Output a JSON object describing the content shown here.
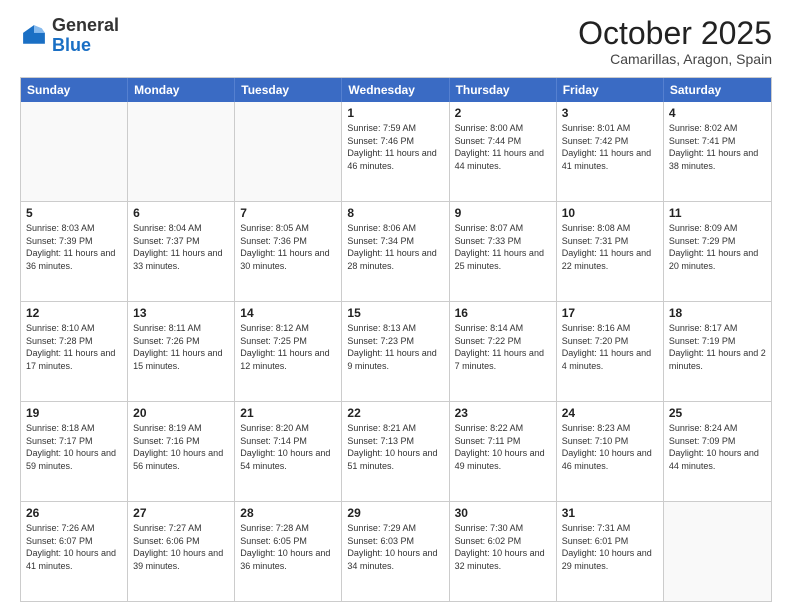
{
  "logo": {
    "general": "General",
    "blue": "Blue"
  },
  "header": {
    "month": "October 2025",
    "location": "Camarillas, Aragon, Spain"
  },
  "days": [
    "Sunday",
    "Monday",
    "Tuesday",
    "Wednesday",
    "Thursday",
    "Friday",
    "Saturday"
  ],
  "rows": [
    [
      {
        "day": "",
        "info": ""
      },
      {
        "day": "",
        "info": ""
      },
      {
        "day": "",
        "info": ""
      },
      {
        "day": "1",
        "info": "Sunrise: 7:59 AM\nSunset: 7:46 PM\nDaylight: 11 hours and 46 minutes."
      },
      {
        "day": "2",
        "info": "Sunrise: 8:00 AM\nSunset: 7:44 PM\nDaylight: 11 hours and 44 minutes."
      },
      {
        "day": "3",
        "info": "Sunrise: 8:01 AM\nSunset: 7:42 PM\nDaylight: 11 hours and 41 minutes."
      },
      {
        "day": "4",
        "info": "Sunrise: 8:02 AM\nSunset: 7:41 PM\nDaylight: 11 hours and 38 minutes."
      }
    ],
    [
      {
        "day": "5",
        "info": "Sunrise: 8:03 AM\nSunset: 7:39 PM\nDaylight: 11 hours and 36 minutes."
      },
      {
        "day": "6",
        "info": "Sunrise: 8:04 AM\nSunset: 7:37 PM\nDaylight: 11 hours and 33 minutes."
      },
      {
        "day": "7",
        "info": "Sunrise: 8:05 AM\nSunset: 7:36 PM\nDaylight: 11 hours and 30 minutes."
      },
      {
        "day": "8",
        "info": "Sunrise: 8:06 AM\nSunset: 7:34 PM\nDaylight: 11 hours and 28 minutes."
      },
      {
        "day": "9",
        "info": "Sunrise: 8:07 AM\nSunset: 7:33 PM\nDaylight: 11 hours and 25 minutes."
      },
      {
        "day": "10",
        "info": "Sunrise: 8:08 AM\nSunset: 7:31 PM\nDaylight: 11 hours and 22 minutes."
      },
      {
        "day": "11",
        "info": "Sunrise: 8:09 AM\nSunset: 7:29 PM\nDaylight: 11 hours and 20 minutes."
      }
    ],
    [
      {
        "day": "12",
        "info": "Sunrise: 8:10 AM\nSunset: 7:28 PM\nDaylight: 11 hours and 17 minutes."
      },
      {
        "day": "13",
        "info": "Sunrise: 8:11 AM\nSunset: 7:26 PM\nDaylight: 11 hours and 15 minutes."
      },
      {
        "day": "14",
        "info": "Sunrise: 8:12 AM\nSunset: 7:25 PM\nDaylight: 11 hours and 12 minutes."
      },
      {
        "day": "15",
        "info": "Sunrise: 8:13 AM\nSunset: 7:23 PM\nDaylight: 11 hours and 9 minutes."
      },
      {
        "day": "16",
        "info": "Sunrise: 8:14 AM\nSunset: 7:22 PM\nDaylight: 11 hours and 7 minutes."
      },
      {
        "day": "17",
        "info": "Sunrise: 8:16 AM\nSunset: 7:20 PM\nDaylight: 11 hours and 4 minutes."
      },
      {
        "day": "18",
        "info": "Sunrise: 8:17 AM\nSunset: 7:19 PM\nDaylight: 11 hours and 2 minutes."
      }
    ],
    [
      {
        "day": "19",
        "info": "Sunrise: 8:18 AM\nSunset: 7:17 PM\nDaylight: 10 hours and 59 minutes."
      },
      {
        "day": "20",
        "info": "Sunrise: 8:19 AM\nSunset: 7:16 PM\nDaylight: 10 hours and 56 minutes."
      },
      {
        "day": "21",
        "info": "Sunrise: 8:20 AM\nSunset: 7:14 PM\nDaylight: 10 hours and 54 minutes."
      },
      {
        "day": "22",
        "info": "Sunrise: 8:21 AM\nSunset: 7:13 PM\nDaylight: 10 hours and 51 minutes."
      },
      {
        "day": "23",
        "info": "Sunrise: 8:22 AM\nSunset: 7:11 PM\nDaylight: 10 hours and 49 minutes."
      },
      {
        "day": "24",
        "info": "Sunrise: 8:23 AM\nSunset: 7:10 PM\nDaylight: 10 hours and 46 minutes."
      },
      {
        "day": "25",
        "info": "Sunrise: 8:24 AM\nSunset: 7:09 PM\nDaylight: 10 hours and 44 minutes."
      }
    ],
    [
      {
        "day": "26",
        "info": "Sunrise: 7:26 AM\nSunset: 6:07 PM\nDaylight: 10 hours and 41 minutes."
      },
      {
        "day": "27",
        "info": "Sunrise: 7:27 AM\nSunset: 6:06 PM\nDaylight: 10 hours and 39 minutes."
      },
      {
        "day": "28",
        "info": "Sunrise: 7:28 AM\nSunset: 6:05 PM\nDaylight: 10 hours and 36 minutes."
      },
      {
        "day": "29",
        "info": "Sunrise: 7:29 AM\nSunset: 6:03 PM\nDaylight: 10 hours and 34 minutes."
      },
      {
        "day": "30",
        "info": "Sunrise: 7:30 AM\nSunset: 6:02 PM\nDaylight: 10 hours and 32 minutes."
      },
      {
        "day": "31",
        "info": "Sunrise: 7:31 AM\nSunset: 6:01 PM\nDaylight: 10 hours and 29 minutes."
      },
      {
        "day": "",
        "info": ""
      }
    ]
  ]
}
